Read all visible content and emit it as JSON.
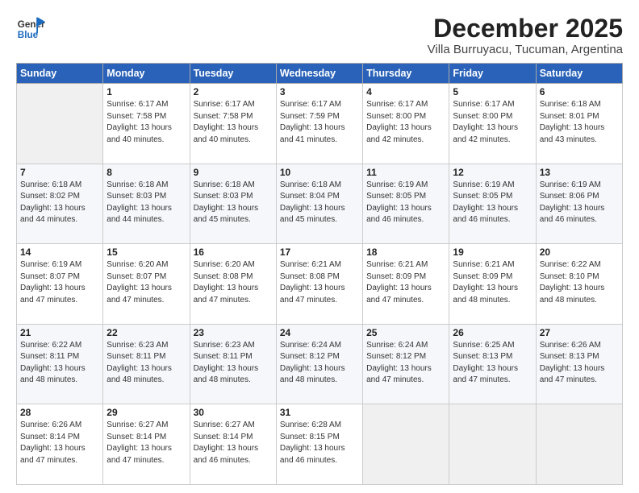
{
  "header": {
    "logo_line1": "General",
    "logo_line2": "Blue",
    "month": "December 2025",
    "location": "Villa Burruyacu, Tucuman, Argentina"
  },
  "weekdays": [
    "Sunday",
    "Monday",
    "Tuesday",
    "Wednesday",
    "Thursday",
    "Friday",
    "Saturday"
  ],
  "weeks": [
    [
      {
        "day": "",
        "info": ""
      },
      {
        "day": "1",
        "info": "Sunrise: 6:17 AM\nSunset: 7:58 PM\nDaylight: 13 hours\nand 40 minutes."
      },
      {
        "day": "2",
        "info": "Sunrise: 6:17 AM\nSunset: 7:58 PM\nDaylight: 13 hours\nand 40 minutes."
      },
      {
        "day": "3",
        "info": "Sunrise: 6:17 AM\nSunset: 7:59 PM\nDaylight: 13 hours\nand 41 minutes."
      },
      {
        "day": "4",
        "info": "Sunrise: 6:17 AM\nSunset: 8:00 PM\nDaylight: 13 hours\nand 42 minutes."
      },
      {
        "day": "5",
        "info": "Sunrise: 6:17 AM\nSunset: 8:00 PM\nDaylight: 13 hours\nand 42 minutes."
      },
      {
        "day": "6",
        "info": "Sunrise: 6:18 AM\nSunset: 8:01 PM\nDaylight: 13 hours\nand 43 minutes."
      }
    ],
    [
      {
        "day": "7",
        "info": "Sunrise: 6:18 AM\nSunset: 8:02 PM\nDaylight: 13 hours\nand 44 minutes."
      },
      {
        "day": "8",
        "info": "Sunrise: 6:18 AM\nSunset: 8:03 PM\nDaylight: 13 hours\nand 44 minutes."
      },
      {
        "day": "9",
        "info": "Sunrise: 6:18 AM\nSunset: 8:03 PM\nDaylight: 13 hours\nand 45 minutes."
      },
      {
        "day": "10",
        "info": "Sunrise: 6:18 AM\nSunset: 8:04 PM\nDaylight: 13 hours\nand 45 minutes."
      },
      {
        "day": "11",
        "info": "Sunrise: 6:19 AM\nSunset: 8:05 PM\nDaylight: 13 hours\nand 46 minutes."
      },
      {
        "day": "12",
        "info": "Sunrise: 6:19 AM\nSunset: 8:05 PM\nDaylight: 13 hours\nand 46 minutes."
      },
      {
        "day": "13",
        "info": "Sunrise: 6:19 AM\nSunset: 8:06 PM\nDaylight: 13 hours\nand 46 minutes."
      }
    ],
    [
      {
        "day": "14",
        "info": "Sunrise: 6:19 AM\nSunset: 8:07 PM\nDaylight: 13 hours\nand 47 minutes."
      },
      {
        "day": "15",
        "info": "Sunrise: 6:20 AM\nSunset: 8:07 PM\nDaylight: 13 hours\nand 47 minutes."
      },
      {
        "day": "16",
        "info": "Sunrise: 6:20 AM\nSunset: 8:08 PM\nDaylight: 13 hours\nand 47 minutes."
      },
      {
        "day": "17",
        "info": "Sunrise: 6:21 AM\nSunset: 8:08 PM\nDaylight: 13 hours\nand 47 minutes."
      },
      {
        "day": "18",
        "info": "Sunrise: 6:21 AM\nSunset: 8:09 PM\nDaylight: 13 hours\nand 47 minutes."
      },
      {
        "day": "19",
        "info": "Sunrise: 6:21 AM\nSunset: 8:09 PM\nDaylight: 13 hours\nand 48 minutes."
      },
      {
        "day": "20",
        "info": "Sunrise: 6:22 AM\nSunset: 8:10 PM\nDaylight: 13 hours\nand 48 minutes."
      }
    ],
    [
      {
        "day": "21",
        "info": "Sunrise: 6:22 AM\nSunset: 8:11 PM\nDaylight: 13 hours\nand 48 minutes."
      },
      {
        "day": "22",
        "info": "Sunrise: 6:23 AM\nSunset: 8:11 PM\nDaylight: 13 hours\nand 48 minutes."
      },
      {
        "day": "23",
        "info": "Sunrise: 6:23 AM\nSunset: 8:11 PM\nDaylight: 13 hours\nand 48 minutes."
      },
      {
        "day": "24",
        "info": "Sunrise: 6:24 AM\nSunset: 8:12 PM\nDaylight: 13 hours\nand 48 minutes."
      },
      {
        "day": "25",
        "info": "Sunrise: 6:24 AM\nSunset: 8:12 PM\nDaylight: 13 hours\nand 47 minutes."
      },
      {
        "day": "26",
        "info": "Sunrise: 6:25 AM\nSunset: 8:13 PM\nDaylight: 13 hours\nand 47 minutes."
      },
      {
        "day": "27",
        "info": "Sunrise: 6:26 AM\nSunset: 8:13 PM\nDaylight: 13 hours\nand 47 minutes."
      }
    ],
    [
      {
        "day": "28",
        "info": "Sunrise: 6:26 AM\nSunset: 8:14 PM\nDaylight: 13 hours\nand 47 minutes."
      },
      {
        "day": "29",
        "info": "Sunrise: 6:27 AM\nSunset: 8:14 PM\nDaylight: 13 hours\nand 47 minutes."
      },
      {
        "day": "30",
        "info": "Sunrise: 6:27 AM\nSunset: 8:14 PM\nDaylight: 13 hours\nand 46 minutes."
      },
      {
        "day": "31",
        "info": "Sunrise: 6:28 AM\nSunset: 8:15 PM\nDaylight: 13 hours\nand 46 minutes."
      },
      {
        "day": "",
        "info": ""
      },
      {
        "day": "",
        "info": ""
      },
      {
        "day": "",
        "info": ""
      }
    ]
  ]
}
